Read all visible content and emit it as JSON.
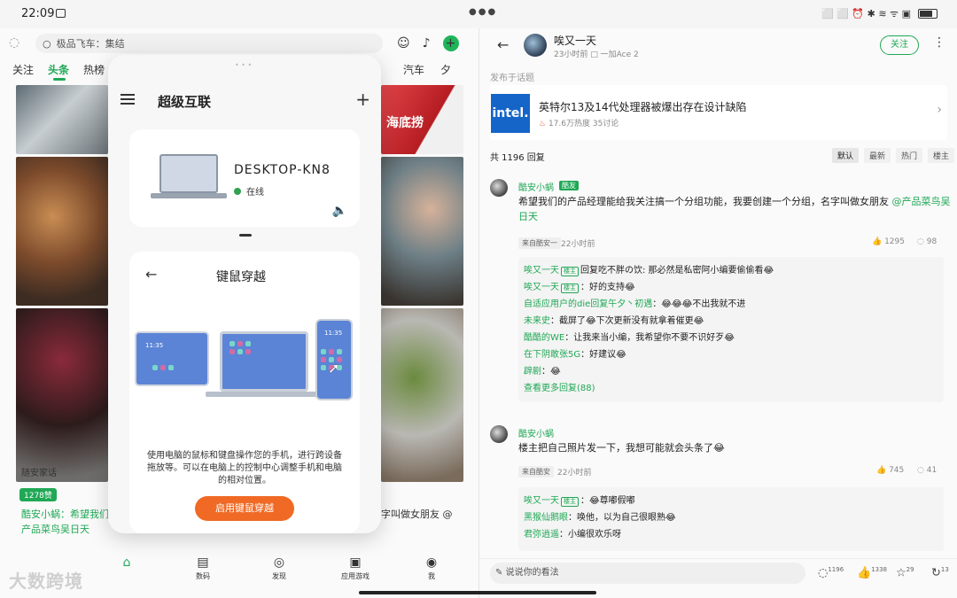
{
  "status_bar": {
    "time": "22:09",
    "right_text": "⬜ ⬜ ⏰ ✱ ≋ ᯤ ▣"
  },
  "left_app": {
    "search_placeholder": "极品飞车：集结",
    "tabs": [
      "关注",
      "头条",
      "热榜"
    ],
    "tabs_right": [
      "汽车",
      "夕"
    ],
    "photo_text": "海底捞",
    "caption": "随安家话",
    "likes_badge": "1278赞",
    "comment_preview_left": "酷安小蜗：希望我们",
    "comment_preview_left2": "产品菜鸟吴日天",
    "comment_preview_right": "字叫做女朋友 @",
    "bottom_nav": [
      {
        "icon": "⌂",
        "label": ""
      },
      {
        "icon": "▤",
        "label": "数码"
      },
      {
        "icon": "◎",
        "label": "发现"
      },
      {
        "icon": "▣",
        "label": "应用游戏"
      },
      {
        "icon": "◉",
        "label": "我"
      }
    ],
    "watermark": "大数跨境"
  },
  "panel": {
    "title": "超级互联",
    "device_name": "DESKTOP-KN8",
    "device_status": "在线",
    "cross_title": "键鼠穿越",
    "screen_time": "11:35",
    "description": "使用电脑的鼠标和键盘操作您的手机，进行跨设备拖放等。可以在电脑上的控制中心调整手机和电脑的相对位置。",
    "cta_label": "启用键鼠穿越"
  },
  "right_app": {
    "user": "唉又一天",
    "meta": "23小时前  □ 一加Ace 2",
    "follow_label": "关注",
    "posted_in": "发布于话题",
    "news_logo": "intel.",
    "news_title": "英特尔13及14代处理器被爆出存在设计缺陷",
    "news_stats": "17.6万热度 35讨论",
    "reply_count": "共 1196 回复",
    "sort_tabs": [
      "默认",
      "最新",
      "热门",
      "楼主"
    ],
    "comment1": {
      "name": "酷安小蜗",
      "tag": "酷友",
      "text": "希望我们的产品经理能给我关注搞一个分组功能，我要创建一个分组，名字叫做女朋友 ",
      "mention": "@产品菜鸟吴日天",
      "source": "来自酷安一",
      "time": "22小时前",
      "likes": "1295",
      "comments": "98",
      "sub_replies": [
        {
          "name": "唉又一天",
          "tag": "楼主",
          "text": "回复吃不胖の饮: 那必然是私密阿小编要偷偷看😂"
        },
        {
          "name": "唉又一天",
          "tag": "楼主",
          "text": "：好的支持😂"
        },
        {
          "name": "自适应用户的die回复午夕丶初遇",
          "tag": "",
          "text": "：😂😂😂不出我就不进"
        },
        {
          "name": "未来史",
          "tag": "",
          "text": "：截屏了😂下次更新没有就拿着催更😂"
        },
        {
          "name": "酷酷的WE",
          "tag": "",
          "text": "：让我来当小编，我希望你不要不识好歹😂"
        },
        {
          "name": "在下阴敢张5G",
          "tag": "",
          "text": "：好建议😂"
        },
        {
          "name": "辟剧",
          "tag": "",
          "text": "：😂"
        }
      ],
      "more": "查看更多回复(88)"
    },
    "comment2": {
      "name": "酷安小蜗",
      "text": "楼主把自己照片发一下，我想可能就会头条了😂",
      "source": "来自酷安",
      "time": "22小时前",
      "likes": "745",
      "comments": "41",
      "sub_replies": [
        {
          "name": "唉又一天",
          "tag": "楼主",
          "text": "：😂尊嘟假嘟"
        },
        {
          "name": "黑猴仙鹅眼",
          "tag": "",
          "text": "：唤他，以为自己很眼熟😂"
        },
        {
          "name": "君弥逍遥",
          "tag": "",
          "text": "：小编很欢乐呀"
        }
      ]
    },
    "bottom": {
      "input_placeholder": "说说你的看法",
      "comments": "1196",
      "likes": "1338",
      "stars": "29",
      "shares": "13"
    }
  }
}
